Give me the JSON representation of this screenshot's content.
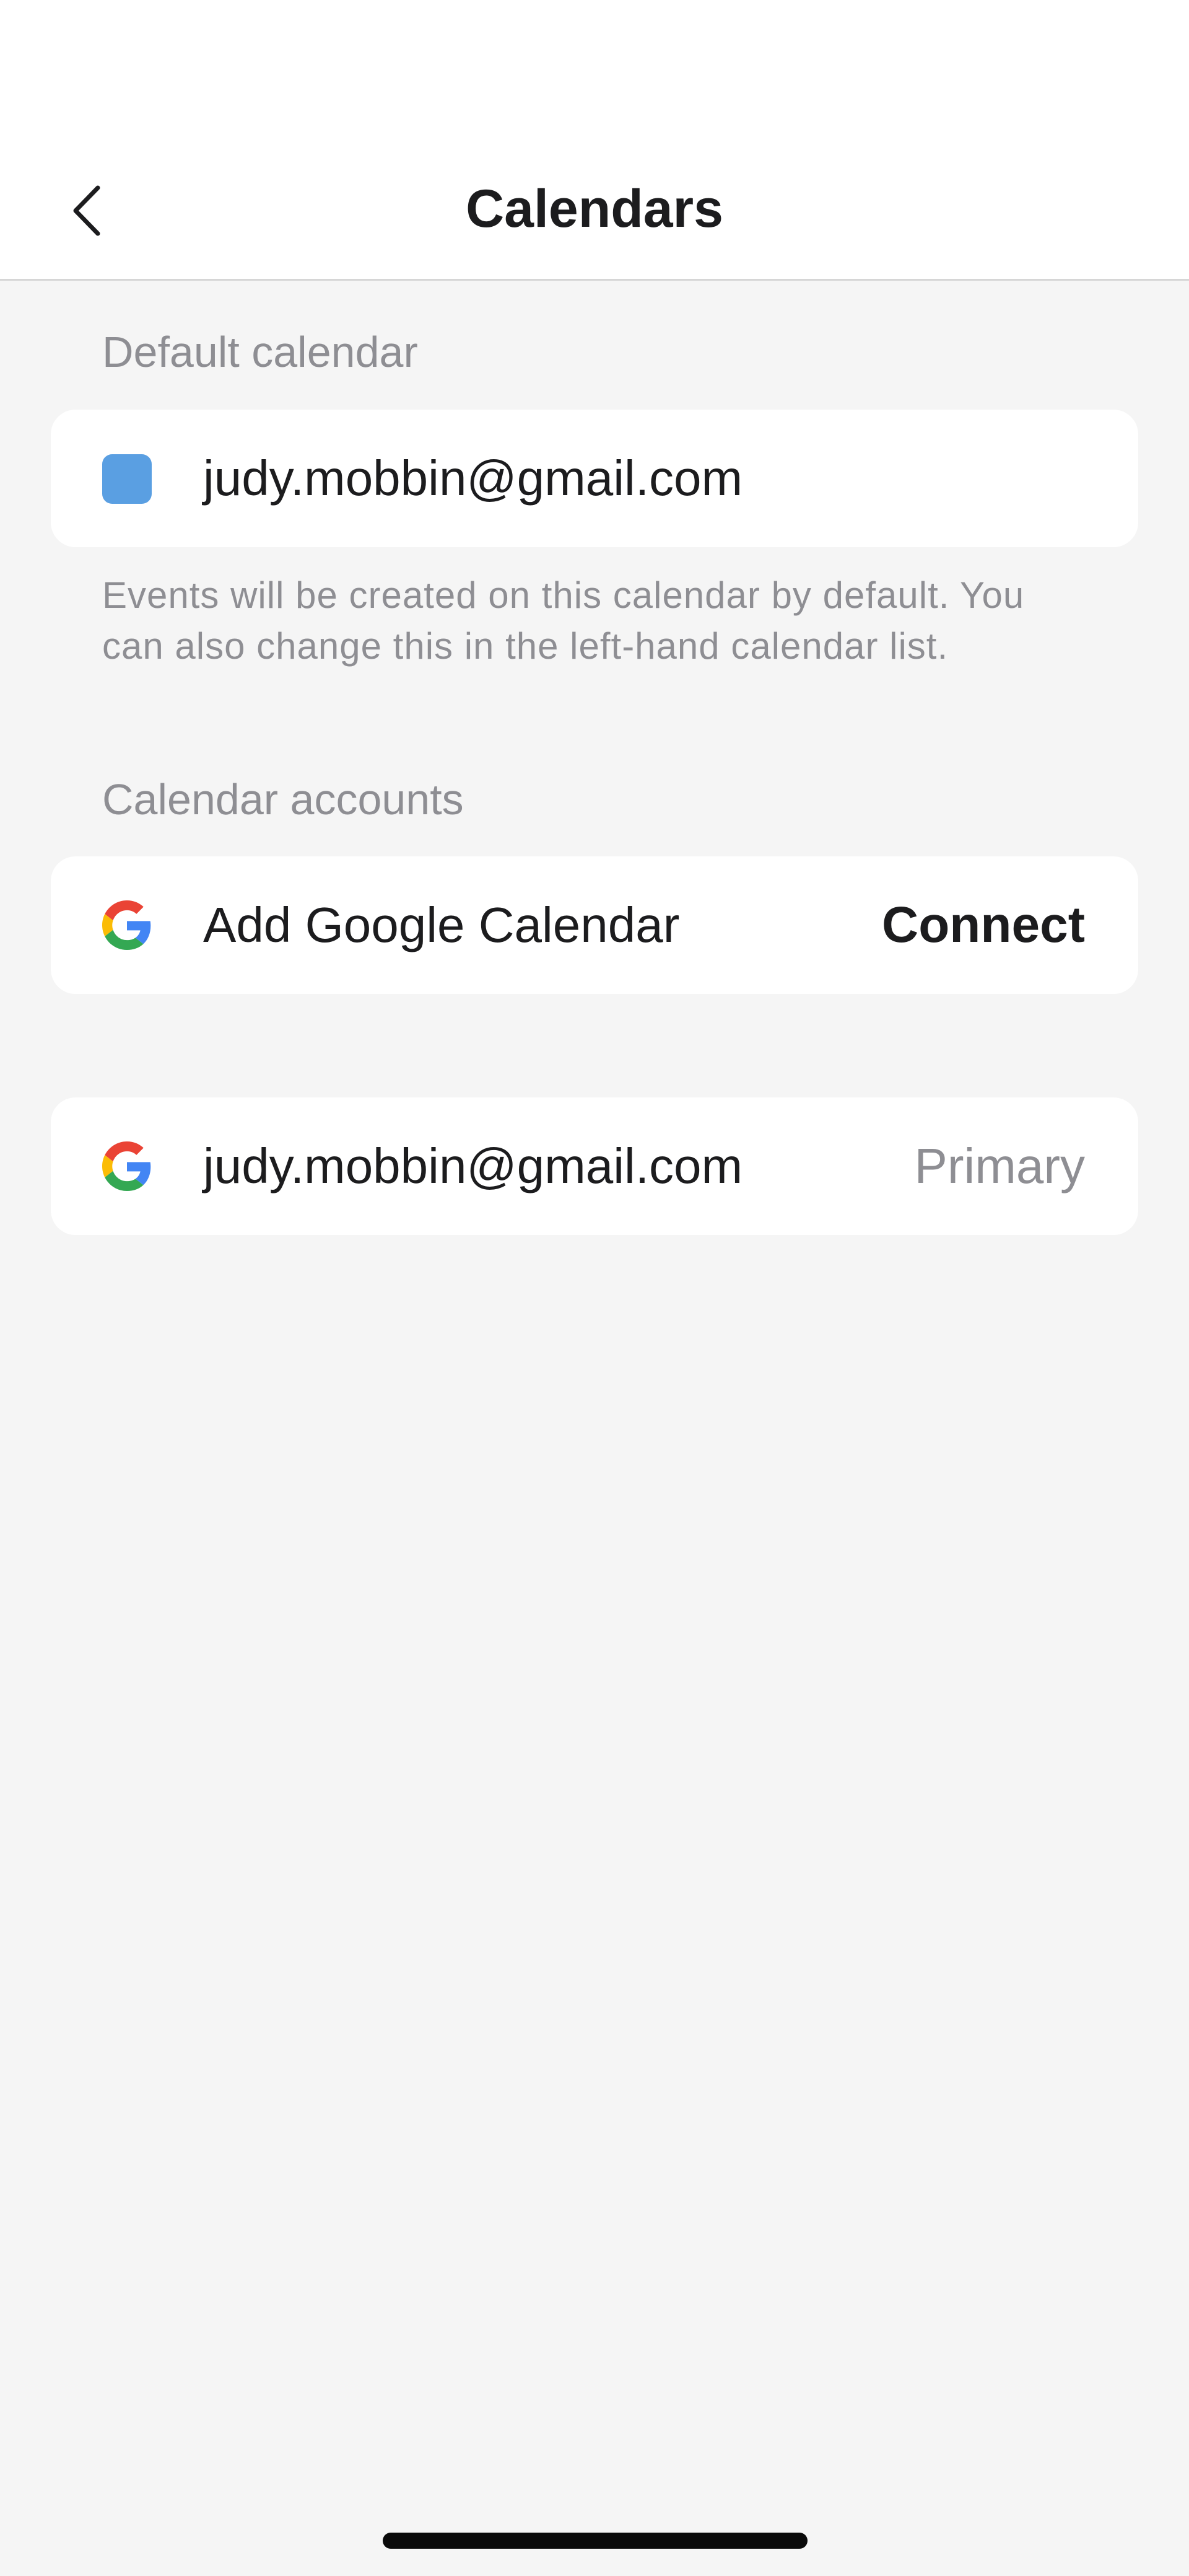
{
  "header": {
    "title": "Calendars",
    "back_icon": "chevron-left-icon"
  },
  "default_calendar": {
    "section_label": "Default calendar",
    "account_email": "judy.mobbin@gmail.com",
    "swatch_color": "#5a9fe2",
    "footnote": "Events will be created on this calendar by default. You can also change this in the left-hand calendar list."
  },
  "calendar_accounts": {
    "section_label": "Calendar accounts",
    "add_row": {
      "icon": "google-icon",
      "label": "Add Google Calendar",
      "action_label": "Connect"
    },
    "accounts": [
      {
        "icon": "google-icon",
        "email": "judy.mobbin@gmail.com",
        "tag": "Primary"
      }
    ]
  }
}
